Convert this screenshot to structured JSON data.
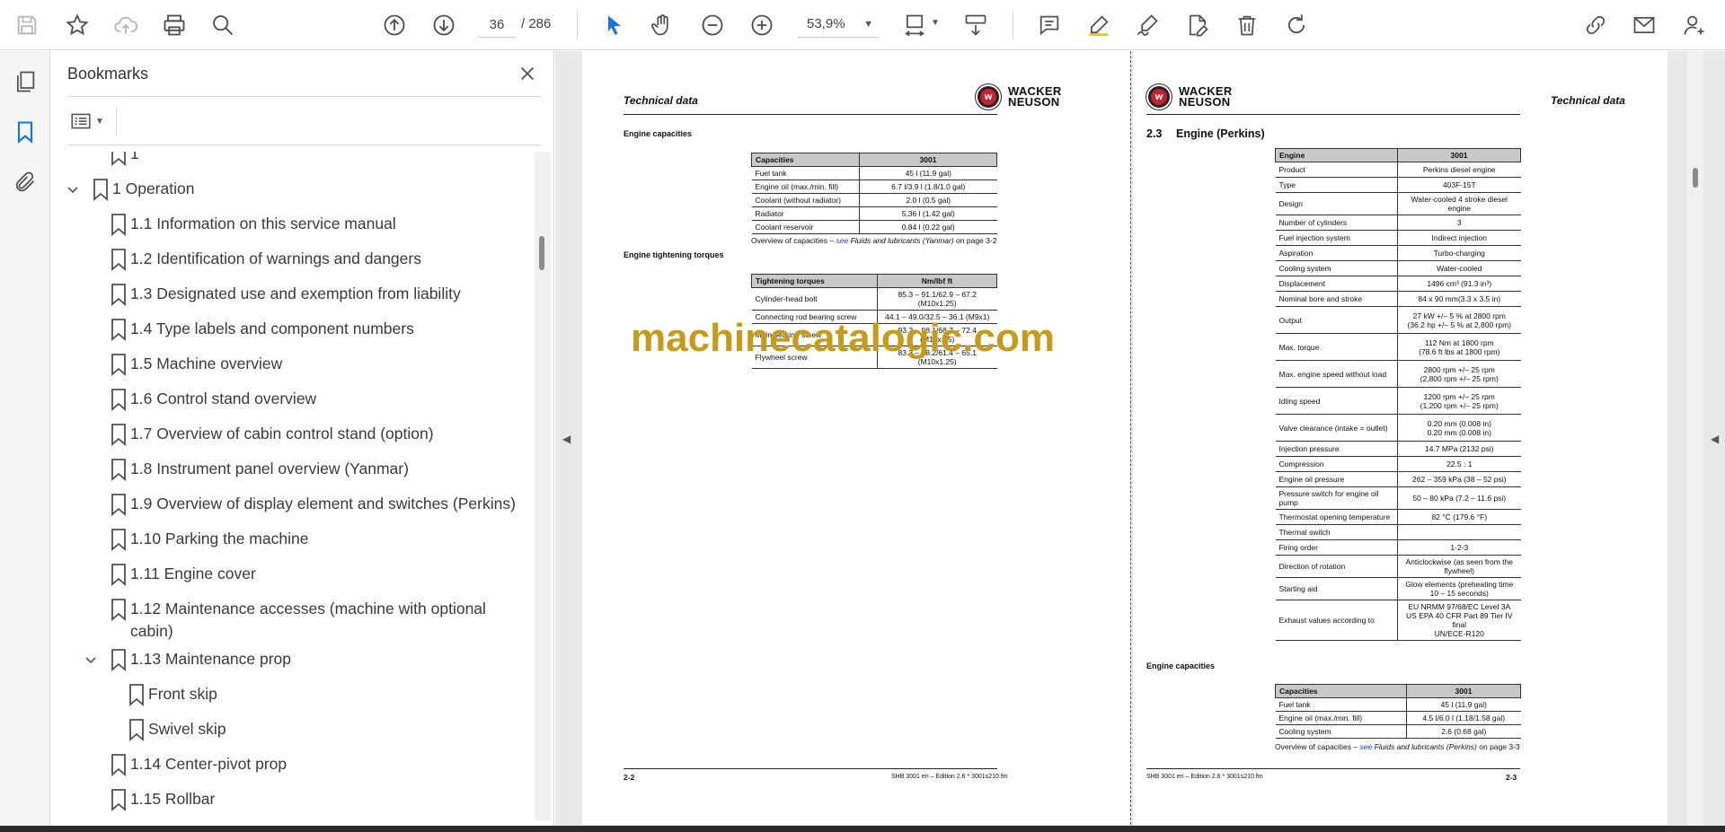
{
  "toolbar": {
    "page_current": "36",
    "page_total": "/ 286",
    "zoom": "53,9%"
  },
  "bookmarks": {
    "title": "Bookmarks",
    "items": [
      {
        "label": "1",
        "level": 1,
        "expander": ""
      },
      {
        "label": "1 Operation",
        "level": 0,
        "expander": "open"
      },
      {
        "label": "1.1 Information on this service manual",
        "level": 1,
        "expander": ""
      },
      {
        "label": "1.2 Identification of warnings and dangers",
        "level": 1,
        "expander": ""
      },
      {
        "label": "1.3 Designated use and exemption from liability",
        "level": 1,
        "expander": ""
      },
      {
        "label": "1.4 Type labels and component numbers",
        "level": 1,
        "expander": ""
      },
      {
        "label": "1.5 Machine overview",
        "level": 1,
        "expander": ""
      },
      {
        "label": "1.6 Control stand overview",
        "level": 1,
        "expander": ""
      },
      {
        "label": "1.7 Overview of cabin control stand (option)",
        "level": 1,
        "expander": ""
      },
      {
        "label": "1.8 Instrument panel overview (Yanmar)",
        "level": 1,
        "expander": ""
      },
      {
        "label": "1.9 Overview of display element and switches (Perkins)",
        "level": 1,
        "expander": ""
      },
      {
        "label": "1.10 Parking the machine",
        "level": 1,
        "expander": ""
      },
      {
        "label": "1.11 Engine cover",
        "level": 1,
        "expander": ""
      },
      {
        "label": "1.12 Maintenance accesses (machine with optional",
        "label2": "cabin)",
        "level": 1,
        "expander": ""
      },
      {
        "label": "1.13 Maintenance prop",
        "level": 1,
        "expander": "open"
      },
      {
        "label": "Front skip",
        "level": 2,
        "expander": ""
      },
      {
        "label": "Swivel skip",
        "level": 2,
        "expander": ""
      },
      {
        "label": "1.14 Center-pivot prop",
        "level": 1,
        "expander": ""
      },
      {
        "label": "1.15 Rollbar",
        "level": 1,
        "expander": ""
      }
    ]
  },
  "left_page": {
    "header": "Technical data",
    "logo_line1": "WACKER",
    "logo_line2": "NEUSON",
    "cap_title": "Engine capacities",
    "cap_table": {
      "headers": [
        "Capacities",
        "3001"
      ],
      "rows": [
        [
          "Fuel tank",
          "45 l (11.9 gal)"
        ],
        [
          "Engine oil (max./min. fill)",
          "6.7 l/3.9 l (1.8/1.0 gal)"
        ],
        [
          "Coolant (without radiator)",
          "2.0 l (0.5 gal)"
        ],
        [
          "Radiator",
          "5.36 l (1.42 gal)"
        ],
        [
          "Coolant reservoir",
          "0.84 l (0.22 gal)"
        ]
      ]
    },
    "cap_note_prefix": "Overview of capacities – ",
    "cap_note_see": "see",
    "cap_note_link": " Fluids and lubricants (Yanmar)",
    "cap_note_suffix": " on page 3-2",
    "torque_title": "Engine tightening torques",
    "torque_table": {
      "headers": [
        "Tightening torques",
        "Nm/lbf ft"
      ],
      "rows": [
        [
          "Cylinder-head bolt",
          "85.3 – 91.1/62.9 – 67.2 (M10x1.25)"
        ],
        [
          "Connecting rod bearing screw",
          "44.1 – 49.0/32.5 – 36.1 (M9x1)"
        ],
        [
          "Main bearing screw",
          "93.2 – 98.1/68.7 – 72.4 (M12x1.5)"
        ],
        [
          "Flywheel screw",
          "83.3 – 88.2/61.4 – 65.1 (M10x1.25)"
        ]
      ]
    },
    "watermark": "machinecatalogic.com",
    "footer_page": "2-2",
    "footer_ref": "SHB 3001 en – Edition 2.6 * 3001s210.fm"
  },
  "right_page": {
    "header": "Technical data",
    "logo_line1": "WACKER",
    "logo_line2": "NEUSON",
    "section_num": "2.3",
    "section_title": "Engine (Perkins)",
    "engine_table": {
      "headers": [
        "Engine",
        "3001"
      ],
      "rows": [
        [
          "Product",
          "Perkins diesel engine"
        ],
        [
          "Type",
          "403F-15T"
        ],
        [
          "Design",
          "Water-cooled 4 stroke diesel engine"
        ],
        [
          "Number of cylinders",
          "3"
        ],
        [
          "Fuel injection system",
          "Indirect injection"
        ],
        [
          "Aspiration",
          "Turbo-charging"
        ],
        [
          "Cooling system",
          "Water-cooled"
        ],
        [
          "Displacement",
          "1496 cm³ (91.3 in³)"
        ],
        [
          "Nominal bore and stroke",
          "84 x 90 mm(3.3 x 3.5 in)"
        ],
        [
          "Output",
          "27 kW +/– 5 % at 2800 rpm\n(36.2 hp +/– 5 % at 2,800 rpm)"
        ],
        [
          "Max. torque",
          "112 Nm at 1800 rpm\n(78.6 ft lbs at 1800 rpm)"
        ],
        [
          "Max. engine speed without load",
          "2800 rpm +/– 25 rpm\n(2,800 rpm +/– 25 rpm)"
        ],
        [
          "Idling speed",
          "1200 rpm +/– 25 rpm\n(1,200 rpm +/– 25 rpm)"
        ],
        [
          "Valve clearance (intake = outlet)",
          "0.20 mm (0.008 in)\n0.20 mm (0.008 in)"
        ],
        [
          "Injection pressure",
          "14.7 MPa (2132 psi)"
        ],
        [
          "Compression",
          "22.5 : 1"
        ],
        [
          "Engine oil pressure",
          "262 – 359 kPa (38 – 52 psi)"
        ],
        [
          "Pressure switch for engine oil pump",
          "50 – 80 kPa (7.2 – 11.6 psi)"
        ],
        [
          "Thermostat opening temperature",
          "82 °C (179.6 °F)"
        ],
        [
          "Thermal switch",
          ""
        ],
        [
          "Firing order",
          "1-2-3"
        ],
        [
          "Direction of rotation",
          "Anticlockwise (as seen from the flywheel)"
        ],
        [
          "Starting aid",
          "Glow elements (preheating time 10 – 15 seconds)"
        ],
        [
          "Exhaust values according to",
          "EU NRMM 97/68/EC Level 3A\nUS EPA 40 CFR Part 89 Tier IV final\nUN/ECE-R120"
        ]
      ]
    },
    "cap_title": "Engine capacities",
    "cap_table": {
      "headers": [
        "Capacities",
        "3001"
      ],
      "rows": [
        [
          "Fuel tank",
          "45 l (11.9 gal)"
        ],
        [
          "Engine oil (max./min. fill)",
          "4.5 l/6.0 l (1.18/1.58 gal)"
        ],
        [
          "Cooling system",
          "2.6 (0.68 gal)"
        ]
      ]
    },
    "cap_note_prefix": "Overview of capacities – ",
    "cap_note_see": "see",
    "cap_note_link": " Fluids and lubricants (Perkins)",
    "cap_note_suffix": " on page 3-3",
    "footer_page": "2-3",
    "footer_ref": "SHB 3001 en – Edition 2.6 * 3001s210.fm"
  }
}
